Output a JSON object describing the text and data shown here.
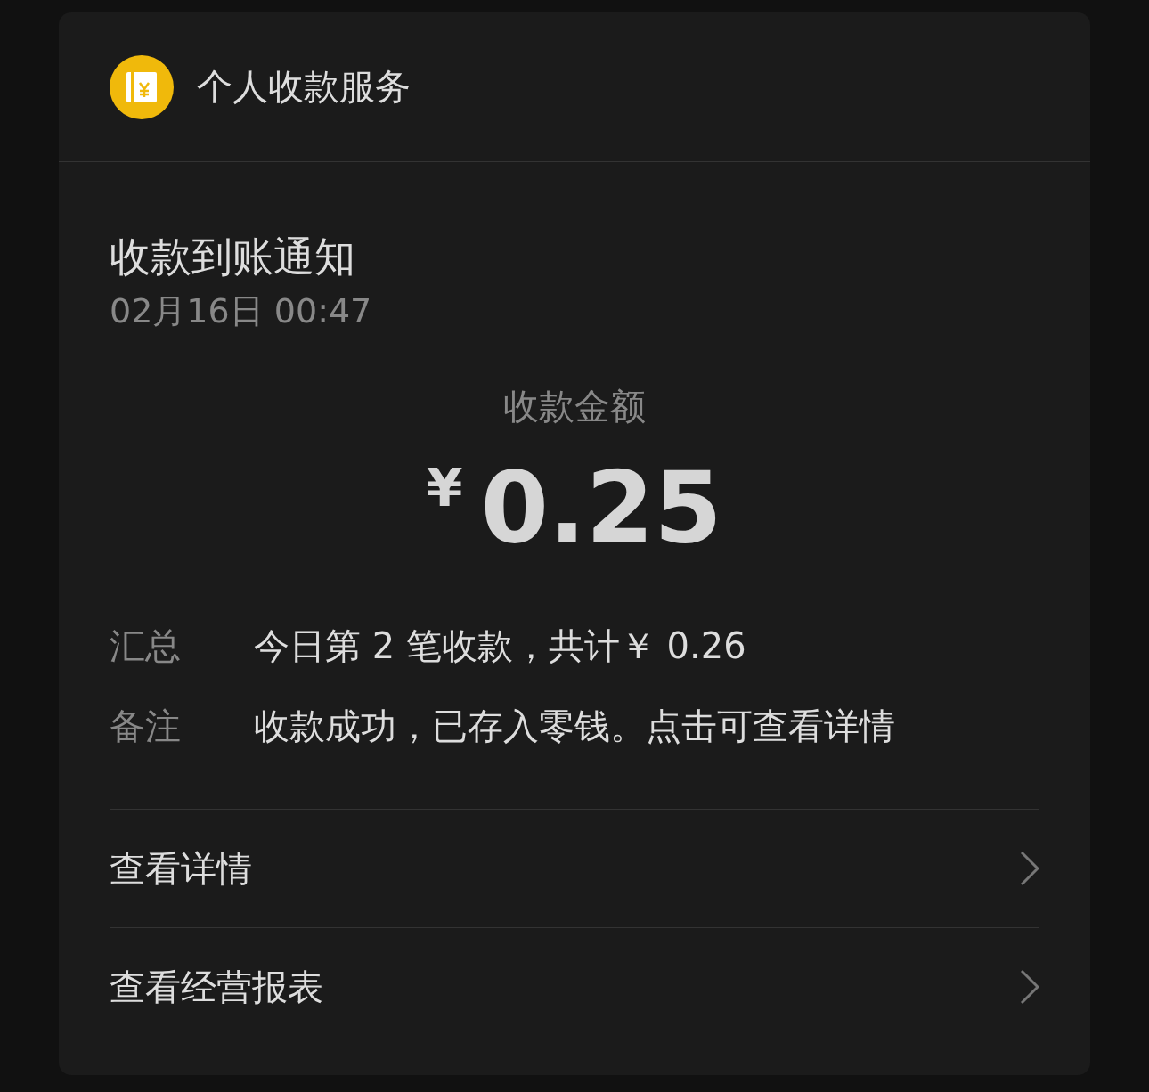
{
  "header": {
    "title": "个人收款服务"
  },
  "notice": {
    "title": "收款到账通知",
    "time": "02月16日 00:47"
  },
  "amount": {
    "label": "收款金额",
    "currency": "¥",
    "value": "0.25"
  },
  "details": [
    {
      "label": "汇总",
      "value": "今日第 2 笔收款，共计￥ 0.26"
    },
    {
      "label": "备注",
      "value": "收款成功，已存入零钱。点击可查看详情"
    }
  ],
  "links": [
    {
      "label": "查看详情"
    },
    {
      "label": "查看经营报表"
    }
  ]
}
